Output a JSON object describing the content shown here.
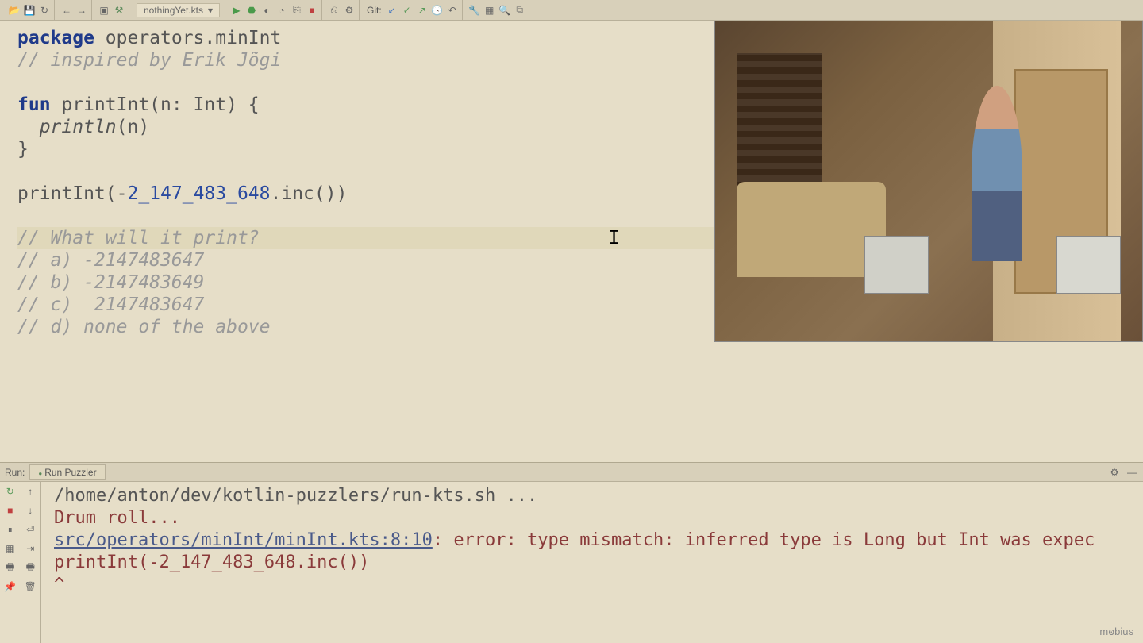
{
  "toolbar": {
    "file_name": "nothingYet.kts",
    "git_label": "Git:"
  },
  "code": {
    "l1_keyword": "package",
    "l1_package": " operators.minInt",
    "l2_comment": "// inspired by Erik Jõgi",
    "l4_keyword": "fun",
    "l4_rest": " printInt(n: Int) {",
    "l5_indent": "  ",
    "l5_func": "println",
    "l5_rest": "(n)",
    "l6": "}",
    "l8_a": "printInt(-",
    "l8_num": "2_147_483_648",
    "l8_b": ".inc())",
    "l10": "// What will it print?",
    "l11": "// a) -2147483647",
    "l12": "// b) -2147483649",
    "l13": "// c)  2147483647",
    "l14": "// d) none of the above"
  },
  "run": {
    "label": "Run:",
    "tab": "Run Puzzler",
    "out1": "/home/anton/dev/kotlin-puzzlers/run-kts.sh ...",
    "out2": "Drum roll...",
    "out3_link": "src/operators/minInt/minInt.kts:8:10",
    "out3_rest": ": error: type mismatch: inferred type is Long but Int was expec",
    "out4": "printInt(-2_147_483_648.inc())",
    "caret_indent": "          ",
    "caret": "^"
  },
  "watermark": "mꙩbius"
}
